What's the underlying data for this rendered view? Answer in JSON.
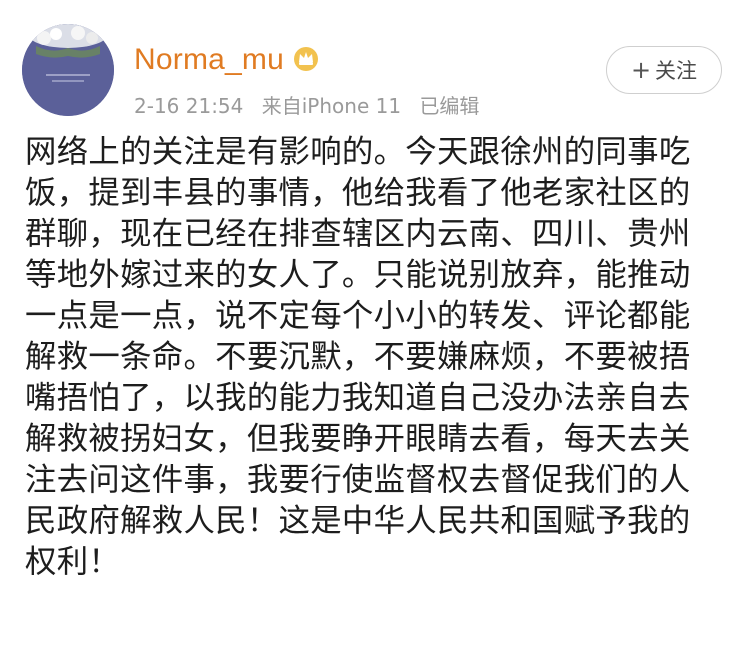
{
  "header": {
    "username": "Norma_mu",
    "date": "2-16 21:54",
    "source": "来自iPhone 11",
    "edited": "已编辑",
    "follow_label": "关注",
    "follow_plus": "+"
  },
  "icons": {
    "avatar": "avatar-image",
    "badge": "crown-badge-icon"
  },
  "colors": {
    "username": "#e07b22",
    "meta": "#9a9a9a",
    "text": "#1d1d1d",
    "button_border": "#cfcfcf"
  },
  "post": {
    "lines": [
      "网络上的关注是有影响的。今天跟徐州的同事吃",
      "饭，提到丰县的事情，他给我看了他老家社区的",
      "群聊，现在已经在排查辖区内云南、四川、贵州",
      "等地外嫁过来的女人了。只能说别放弃，能推动",
      "一点是一点，说不定每个小小的转发、评论都能",
      "解救一条命。不要沉默，不要嫌麻烦，不要被捂",
      "嘴捂怕了，以我的能力我知道自己没办法亲自去",
      "解救被拐妇女，但我要睁开眼睛去看，每天去关",
      "注去问这件事，我要行使监督权去督促我们的人",
      "民政府解救人民！这是中华人民共和国赋予我的",
      "权利！"
    ]
  }
}
